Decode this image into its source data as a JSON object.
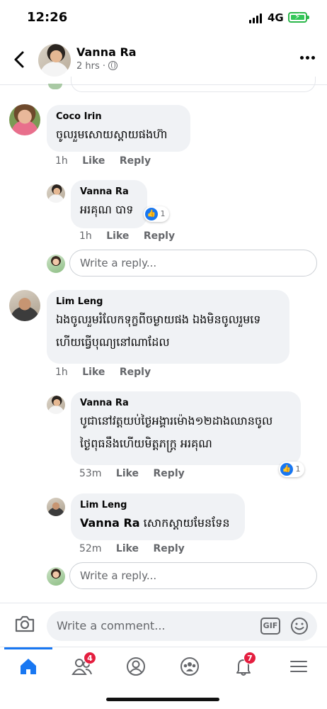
{
  "status_bar": {
    "time": "12:26",
    "network": "4G"
  },
  "header": {
    "name": "Vanna Ra",
    "meta": "2 hrs ·"
  },
  "comments": [
    {
      "author": "Coco Irin",
      "text_lines": [
        "ចូលរួមសោយស្តាយផងហ៊ា"
      ],
      "time": "1h",
      "like": "Like",
      "reply": "Reply"
    },
    {
      "author": "Vanna Ra",
      "text_lines": [
        "អរគុណ បាទ"
      ],
      "time": "1h",
      "like": "Like",
      "reply": "Reply",
      "reactions": "1"
    },
    {
      "author": "Lim Leng",
      "text_lines": [
        "ឯងចូលរួមរំលែកទុក្ខពីចម្ងាយផង ឯងមិនចូលរួមទេ",
        "ហើយធ្វើបុណ្យនៅណាដែល"
      ],
      "time": "1h",
      "like": "Like",
      "reply": "Reply"
    },
    {
      "author": "Vanna Ra",
      "text_lines": [
        "បូជានៅវត្តយប់ថ្ងៃអង្គារម៉ោង១២ដាងឈានចូល",
        "ថ្ងៃពុធនឹងហើយមិត្តភក្ត្រ អរគុណ"
      ],
      "time": "53m",
      "like": "Like",
      "reply": "Reply",
      "reactions": "1"
    },
    {
      "author": "Lim Leng",
      "mention": "Vanna Ra",
      "text": "សោកស្តាយមែនទែន",
      "time": "52m",
      "like": "Like",
      "reply": "Reply"
    }
  ],
  "reply_placeholder": "Write a reply...",
  "composer": {
    "placeholder": "Write a comment...",
    "gif_label": "GIF"
  },
  "tabbar": {
    "friends_badge": "4",
    "notifications_badge": "7"
  },
  "colors": {
    "accent": "#1877f2",
    "bubble": "#f0f2f5",
    "badge": "#e41e3f"
  }
}
